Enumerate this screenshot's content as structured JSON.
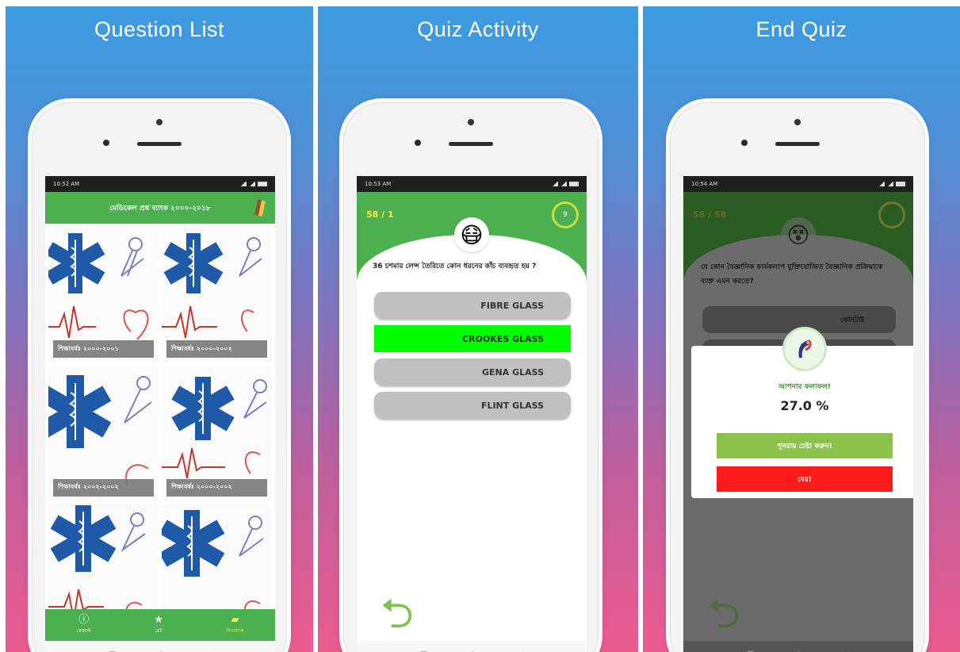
{
  "panels": [
    {
      "title": "Question List"
    },
    {
      "title": "Quiz Activity"
    },
    {
      "title": "End Quiz"
    }
  ],
  "status": [
    {
      "time": "10:52 AM"
    },
    {
      "time": "10:53 AM"
    },
    {
      "time": "10:54 AM"
    }
  ],
  "question_list": {
    "app_title": "মেডিকেল প্রশ্ন ব্যাংক ২০০০-২০১৮",
    "cards": [
      {
        "label": "শিক্ষাবর্ষঃ ২০০০-২০০১"
      },
      {
        "label": "শিক্ষাবর্ষঃ ২০০০-২০০২"
      },
      {
        "label": "শিক্ষাবর্ষঃ ২০০২-২০০২"
      },
      {
        "label": "শিক্ষাবর্ষঃ ২০০০-২০০২"
      },
      {
        "label": ""
      },
      {
        "label": ""
      }
    ],
    "bottom_nav": [
      {
        "label": "রেজাল্ট",
        "icon": "info-icon"
      },
      {
        "label": "রেট",
        "icon": "star-icon"
      },
      {
        "label": "ফিডব্যাক",
        "icon": "chat-icon"
      }
    ]
  },
  "quiz": {
    "score": "58 / 1",
    "timer": "9",
    "question": "36 চশমার লেন্স তৈরিতে কোন ধরনের কাঁচ ব্যবহৃত হয় ?",
    "options": [
      {
        "label": "FIBRE GLASS",
        "state": "normal"
      },
      {
        "label": "CROOKES GLASS",
        "state": "correct"
      },
      {
        "label": "GENA GLASS",
        "state": "normal"
      },
      {
        "label": "FLINT GLASS",
        "state": "normal"
      }
    ]
  },
  "end_quiz": {
    "score": "58 / 58",
    "question": "যে কোন বৈজ্ঞানিক কার্যকলাপ যুক্তিযোজিত বৈজ্ঞানিক প্রক্রিয়াকে ব্যক্ত এমন করতে?",
    "option": "কোনটাই",
    "result_title": "আপনার ফলাফল!",
    "result_value": "27.0 %",
    "retry_label": "পুনরায় চেষ্টা করুন!",
    "exit_label": "বের!"
  },
  "colors": {
    "green": "#4caf50",
    "correct": "#00ff00",
    "retry": "#8bc34a",
    "exit": "#ff1a1a"
  }
}
